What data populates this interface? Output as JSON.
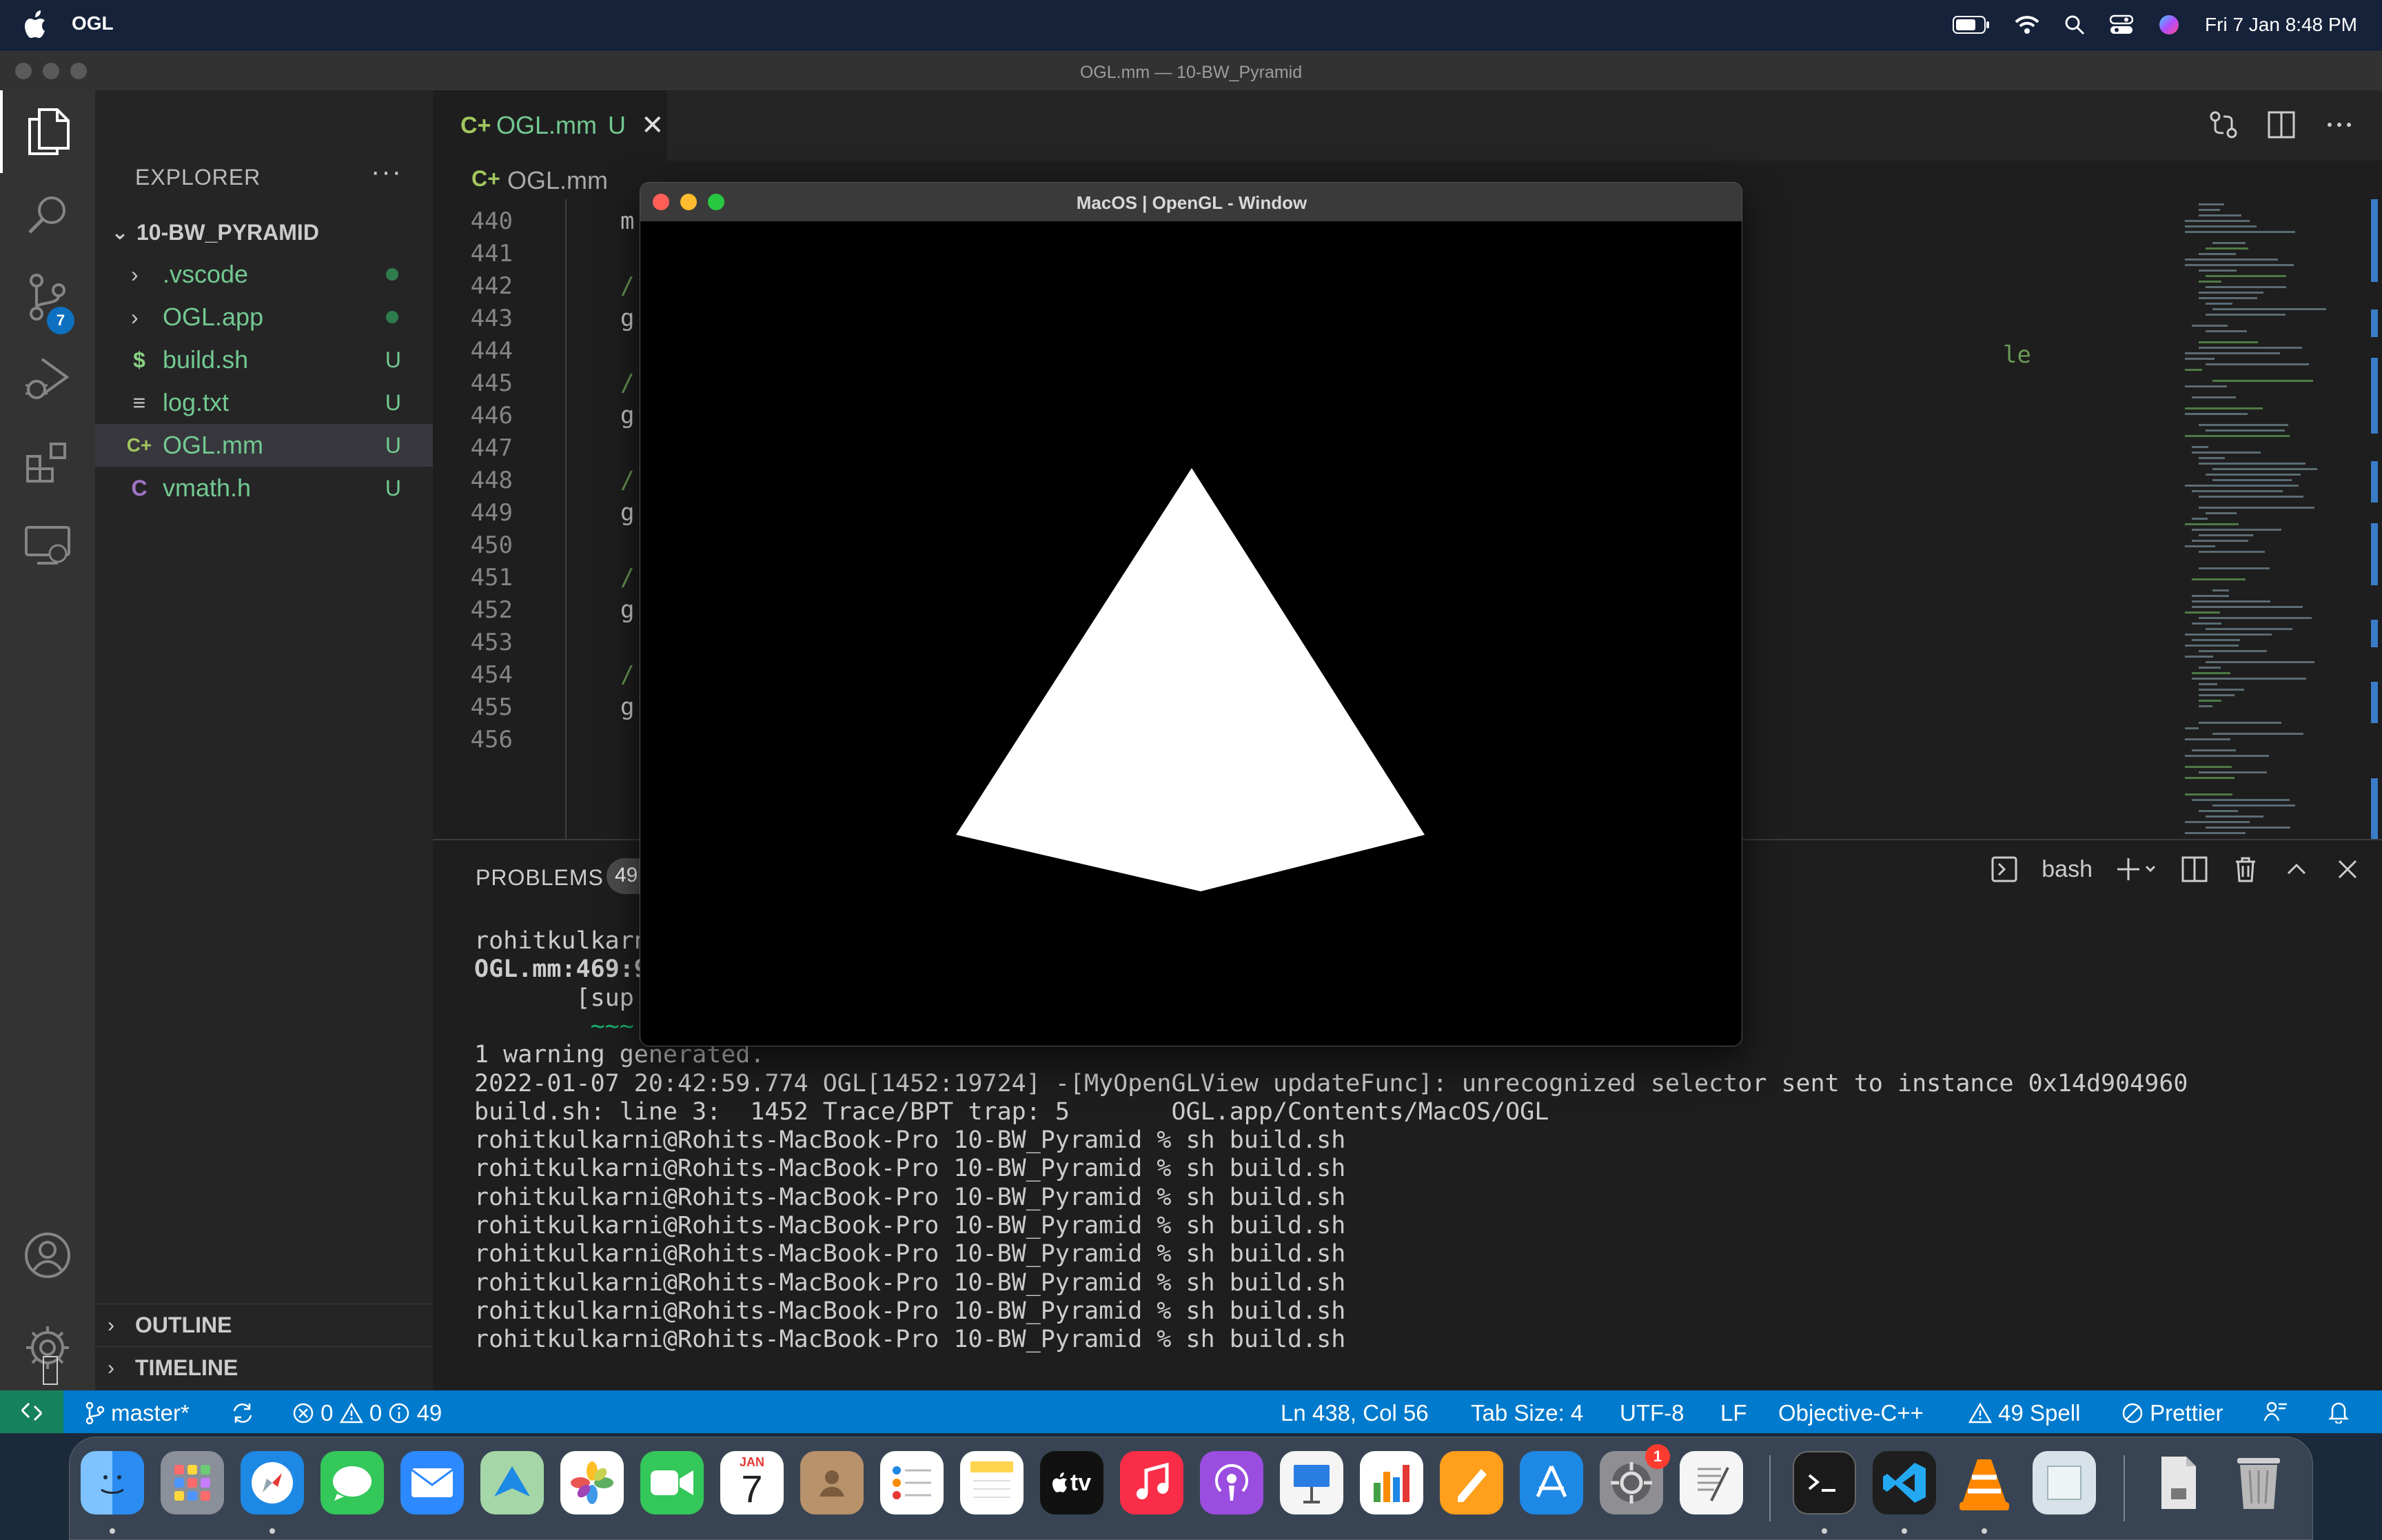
{
  "menubar": {
    "app_name": "OGL",
    "datetime": "Fri 7 Jan  8:48 PM"
  },
  "window": {
    "title": "OGL.mm — 10-BW_Pyramid"
  },
  "activity_bar": {
    "source_control_badge": "7"
  },
  "explorer": {
    "title": "EXPLORER",
    "more": "···",
    "root": "10-BW_PYRAMID",
    "items": [
      {
        "name": ".vscode",
        "type": "folder",
        "status": "dot"
      },
      {
        "name": "OGL.app",
        "type": "folder",
        "status": "dot"
      },
      {
        "name": "build.sh",
        "type": "file",
        "icon": "$",
        "status": "U"
      },
      {
        "name": "log.txt",
        "type": "file",
        "icon": "≡",
        "status": "U"
      },
      {
        "name": "OGL.mm",
        "type": "file",
        "icon": "C+",
        "status": "U",
        "selected": true
      },
      {
        "name": "vmath.h",
        "type": "file",
        "icon": "C",
        "status": "U"
      }
    ],
    "outline": "OUTLINE",
    "timeline": "TIMELINE"
  },
  "editor": {
    "tab": {
      "name": "OGL.mm",
      "status": "U"
    },
    "breadcrumb": "OGL.mm",
    "line_numbers": [
      "440",
      "441",
      "442",
      "443",
      "444",
      "445",
      "446",
      "447",
      "448",
      "449",
      "450",
      "451",
      "452",
      "453",
      "454",
      "455",
      "456"
    ],
    "lines": [
      "m",
      "",
      "/",
      "g",
      "",
      "/",
      "g",
      "",
      "/",
      "g",
      "",
      "/",
      "g",
      "",
      "/",
      "g",
      ""
    ],
    "tail_fragment": "le"
  },
  "panel": {
    "problems_label": "PROBLEMS",
    "problems_count": "49",
    "shell": "bash",
    "terminal": [
      {
        "text": "rohitkulkarn",
        "bold": false
      },
      {
        "text": "OGL.mm:469:9",
        "bold": true
      },
      {
        "text": "       [sup",
        "bold": false
      },
      {
        "text": "        ~~~",
        "bold": false,
        "color": "#19b36b"
      },
      {
        "text": "1 warning generated.",
        "bold": false
      },
      {
        "text": "2022-01-07 20:42:59.774 OGL[1452:19724] -[MyOpenGLView updateFunc]: unrecognized selector sent to instance 0x14d904960",
        "bold": false
      },
      {
        "text": "build.sh: line 3:  1452 Trace/BPT trap: 5       OGL.app/Contents/MacOS/OGL",
        "bold": false
      },
      {
        "text": "rohitkulkarni@Rohits-MacBook-Pro 10-BW_Pyramid % sh build.sh",
        "bold": false
      },
      {
        "text": "rohitkulkarni@Rohits-MacBook-Pro 10-BW_Pyramid % sh build.sh",
        "bold": false
      },
      {
        "text": "rohitkulkarni@Rohits-MacBook-Pro 10-BW_Pyramid % sh build.sh",
        "bold": false
      },
      {
        "text": "rohitkulkarni@Rohits-MacBook-Pro 10-BW_Pyramid % sh build.sh",
        "bold": false
      },
      {
        "text": "rohitkulkarni@Rohits-MacBook-Pro 10-BW_Pyramid % sh build.sh",
        "bold": false
      },
      {
        "text": "rohitkulkarni@Rohits-MacBook-Pro 10-BW_Pyramid % sh build.sh",
        "bold": false
      },
      {
        "text": "rohitkulkarni@Rohits-MacBook-Pro 10-BW_Pyramid % sh build.sh",
        "bold": false
      },
      {
        "text": "rohitkulkarni@Rohits-MacBook-Pro 10-BW_Pyramid % sh build.sh",
        "bold": false
      }
    ]
  },
  "statusbar": {
    "branch": "master*",
    "errors": "0",
    "warnings": "0",
    "info": "49",
    "position": "Ln 438, Col 56",
    "tab_size": "Tab Size: 4",
    "encoding": "UTF-8",
    "eol": "LF",
    "language": "Objective-C++",
    "spell": "49 Spell",
    "prettier": "Prettier"
  },
  "gl_window": {
    "title": "MacOS | OpenGL - Window",
    "background": "#000000",
    "pyramid_color": "#ffffff"
  },
  "dock": {
    "calendar_month": "JAN",
    "calendar_day": "7",
    "settings_badge": "1",
    "appletv_label": "tv",
    "items": [
      "finder",
      "launchpad",
      "safari",
      "messages",
      "mail",
      "maps",
      "photos",
      "facetime",
      "calendar",
      "contacts",
      "reminders",
      "notes",
      "appletv",
      "music",
      "podcasts",
      "keynote",
      "numbers",
      "pages",
      "appstore",
      "system-preferences",
      "textedit",
      "terminal",
      "vscode",
      "vlc",
      "preview",
      "downloads",
      "trash"
    ]
  }
}
